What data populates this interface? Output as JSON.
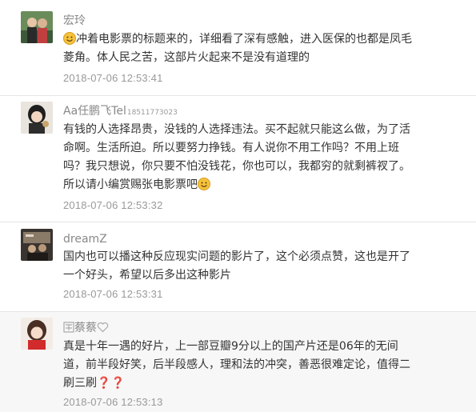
{
  "comments": [
    {
      "username": "宏玲",
      "emoji_icon": "smile-icon",
      "lines": [
        "冲着电影票的标题来的，详细看了深有感触，进入医保的也都是凤毛",
        "菱角。体人民之苦，这部片火起来不是没有道理的"
      ],
      "time": "2018-07-06 12:53:41"
    },
    {
      "username": "Aa任鹏飞Tel",
      "username_tail": "18511773023",
      "lines": [
        "有钱的人选择昂贵，没钱的人选择违法。买不起就只能这么做，为了活",
        "命啊。生活所迫。所以要努力挣钱。有人说你不用工作吗？不用上班",
        "吗？我只想说，你只要不怕没钱花，你也可以，我都穷的就剩裤衩了。",
        "所以请小编赏赐张电影票吧"
      ],
      "emoji_icon": "smile-icon",
      "time": "2018-07-06 12:53:32"
    },
    {
      "username": "dreamZ",
      "lines": [
        "国内也可以播这种反应现实问题的影片了，这个必须点赞，这也是开了",
        "一个好头，希望以后多出这种影片"
      ],
      "time": "2018-07-06 12:53:31"
    },
    {
      "username": "蔡蔡",
      "name_icons": [
        "decorative-text-icon",
        "heart-outline-icon"
      ],
      "lines": [
        "真是十年一遇的好片，上一部豆瓣9分以上的国产片还是06年的无间",
        "道，前半段好笑，后半段感人，理和法的冲突，善恶很难定论，值得二",
        "刷三刷"
      ],
      "marks": [
        "❓",
        "❓"
      ],
      "time": "2018-07-06 12:53:13"
    }
  ],
  "colors": {
    "username": "#888888",
    "time": "#999999",
    "text": "#333333",
    "question": "#e02020"
  }
}
